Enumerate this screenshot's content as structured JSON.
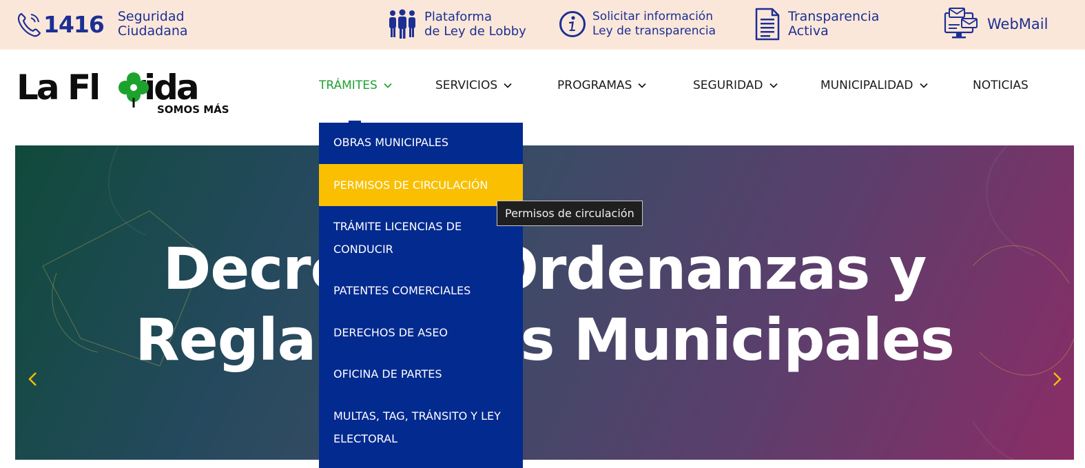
{
  "topbar": {
    "phone": {
      "number": "1416",
      "line1": "Seguridad",
      "line2": "Ciudadana",
      "icon": "phone-icon"
    },
    "lobby": {
      "line1": "Plataforma",
      "line2": "de Ley de Lobby",
      "icon": "people-icon"
    },
    "info": {
      "line1": "Solicitar información",
      "line2": "Ley de transparencia",
      "icon": "info-icon"
    },
    "transparency": {
      "line1": "Transparencia",
      "line2": "Activa",
      "icon": "document-icon"
    },
    "webmail": {
      "label": "WebMail",
      "icon": "computer-mail-icon"
    },
    "color": "#1c2f94",
    "background": "#fbe7d9"
  },
  "logo": {
    "word_left": "La Fl",
    "word_right": "rida",
    "subtitle": "SOMOS MÁS",
    "accent": "#1ea22e"
  },
  "nav": {
    "items": [
      {
        "label": "TRÁMITES",
        "has_dropdown": true,
        "active": true
      },
      {
        "label": "SERVICIOS",
        "has_dropdown": true,
        "active": false
      },
      {
        "label": "PROGRAMAS",
        "has_dropdown": true,
        "active": false
      },
      {
        "label": "SEGURIDAD",
        "has_dropdown": true,
        "active": false
      },
      {
        "label": "MUNICIPALIDAD",
        "has_dropdown": true,
        "active": false
      },
      {
        "label": "NOTICIAS",
        "has_dropdown": false,
        "active": false
      }
    ],
    "active_color": "#1ea22e"
  },
  "hero": {
    "line1": "Decretos, Ordenanzas y",
    "line2": "Reglamentos Municipales",
    "arrow_color": "#f9bf00"
  },
  "dropdown": {
    "background": "#032a8f",
    "highlight": "#f9bf00",
    "items": [
      {
        "label": "OBRAS MUNICIPALES"
      },
      {
        "label": "PERMISOS DE CIRCULACIÓN",
        "highlighted": true
      },
      {
        "label": "TRÁMITE LICENCIAS DE CONDUCIR"
      },
      {
        "label": "PATENTES COMERCIALES"
      },
      {
        "label": "DERECHOS DE ASEO"
      },
      {
        "label": "OFICINA DE PARTES"
      },
      {
        "label": "MULTAS, TAG, TRÁNSITO Y LEY ELECTORAL"
      }
    ]
  },
  "tooltip": {
    "text": "Permisos de circulación"
  }
}
